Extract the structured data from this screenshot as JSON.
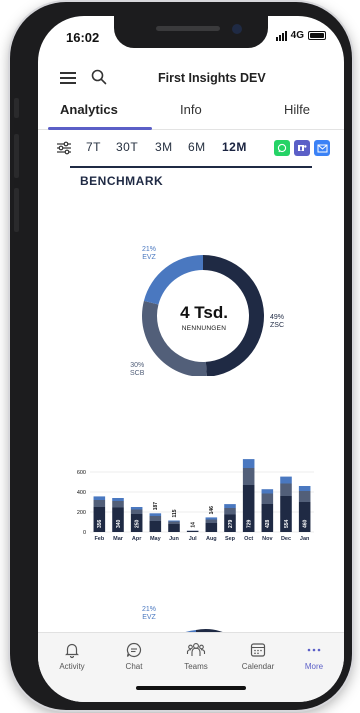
{
  "status": {
    "time": "16:02",
    "network": "4G"
  },
  "header": {
    "title": "First Insights DEV",
    "menu_icon": "hamburger-icon",
    "search_icon": "search-icon"
  },
  "tabs": [
    {
      "label": "Analytics",
      "active": true
    },
    {
      "label": "Info",
      "active": false
    },
    {
      "label": "Hilfe",
      "active": false
    }
  ],
  "filters": {
    "icon": "sliders-icon",
    "periods": [
      {
        "label": "7T",
        "active": false
      },
      {
        "label": "30T",
        "active": false
      },
      {
        "label": "3M",
        "active": false
      },
      {
        "label": "6M",
        "active": false
      },
      {
        "label": "12M",
        "active": true
      }
    ],
    "share": [
      {
        "name": "whatsapp-icon",
        "color": "#25d366"
      },
      {
        "name": "teams-icon",
        "color": "#5b5fc7"
      },
      {
        "name": "mail-icon",
        "color": "#3b82f6"
      }
    ]
  },
  "section": {
    "title": "BENCHMARK"
  },
  "donut": {
    "center_value": "4 Tsd.",
    "center_label": "NENNUNGEN",
    "segments": [
      {
        "pct": "49%",
        "name": "ZSC",
        "value": 49,
        "color": "#1f2a44"
      },
      {
        "pct": "30%",
        "name": "SCB",
        "value": 30,
        "color": "#525f79"
      },
      {
        "pct": "21%",
        "name": "EVZ",
        "value": 21,
        "color": "#4a78c0"
      }
    ]
  },
  "chart_data": {
    "type": "bar",
    "stacked": true,
    "categories": [
      "Feb",
      "Mar",
      "Apr",
      "May",
      "Jun",
      "Jul",
      "Aug",
      "Sep",
      "Oct",
      "Nov",
      "Dec",
      "Jan"
    ],
    "totals": [
      356,
      340,
      250,
      187,
      115,
      14,
      146,
      279,
      729,
      428,
      554,
      460
    ],
    "series": [
      {
        "values": [
          250,
          245,
          180,
          110,
          80,
          10,
          90,
          175,
          470,
          280,
          360,
          300
        ],
        "color": "#1f2a44"
      },
      {
        "values": [
          70,
          65,
          45,
          50,
          25,
          3,
          35,
          65,
          170,
          105,
          125,
          110
        ],
        "color": "#525f79"
      },
      {
        "values": [
          36,
          30,
          25,
          27,
          10,
          1,
          21,
          39,
          89,
          43,
          69,
          50
        ],
        "color": "#4a78c0"
      }
    ],
    "yticks": [
      0,
      200,
      400,
      600
    ],
    "ylim": [
      0,
      800
    ],
    "grid": true
  },
  "donut2": {
    "pct": "21%",
    "name": "EVZ"
  },
  "bottom_nav": [
    {
      "label": "Activity",
      "icon": "bell-icon",
      "active": false
    },
    {
      "label": "Chat",
      "icon": "chat-icon",
      "active": false
    },
    {
      "label": "Teams",
      "icon": "teams-people-icon",
      "active": false
    },
    {
      "label": "Calendar",
      "icon": "calendar-icon",
      "active": false
    },
    {
      "label": "More",
      "icon": "more-dots-icon",
      "active": true
    }
  ]
}
